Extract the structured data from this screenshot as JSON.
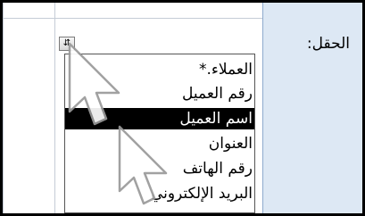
{
  "side_panel": {
    "field_label": "الحقل:"
  },
  "grid": {
    "filter_button_glyph": "⇵"
  },
  "dropdown": {
    "items": [
      {
        "label": "العملاء.*"
      },
      {
        "label": "رقم العميل"
      },
      {
        "label": "اسم العميل",
        "selected": true
      },
      {
        "label": "العنوان"
      },
      {
        "label": "رقم الهاتف"
      },
      {
        "label": "البريد الإلكتروني"
      }
    ]
  }
}
